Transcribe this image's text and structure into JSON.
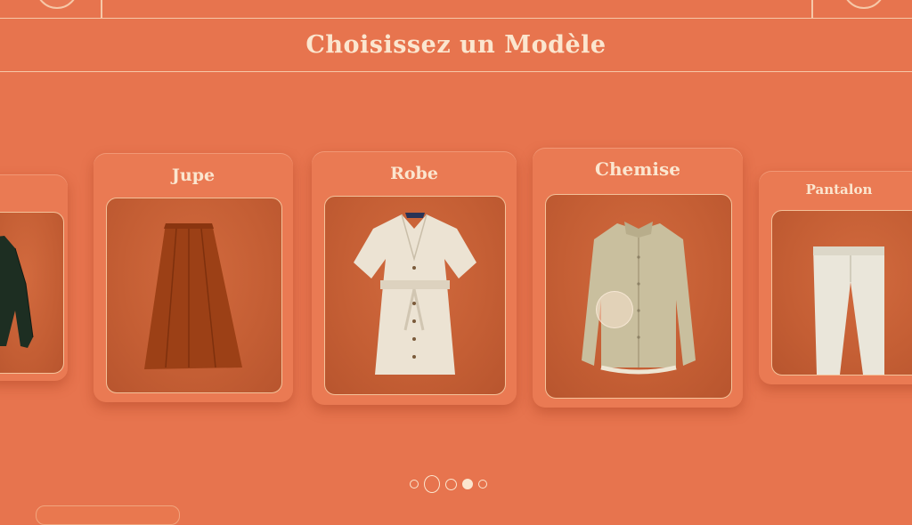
{
  "header": {
    "title": "Choisissez un Modèle"
  },
  "models": [
    {
      "label": "",
      "icon": "sweater-icon"
    },
    {
      "label": "Jupe",
      "icon": "skirt-icon"
    },
    {
      "label": "Robe",
      "icon": "dress-icon"
    },
    {
      "label": "Chemise",
      "icon": "shirt-icon"
    },
    {
      "label": "Pantalon",
      "icon": "trousers-icon"
    }
  ],
  "pager": {
    "count": 5,
    "active_index": 3
  },
  "colors": {
    "background": "#e7744e",
    "accent_text": "#fbe6cf",
    "photo_backdrop": "#c45e34"
  }
}
